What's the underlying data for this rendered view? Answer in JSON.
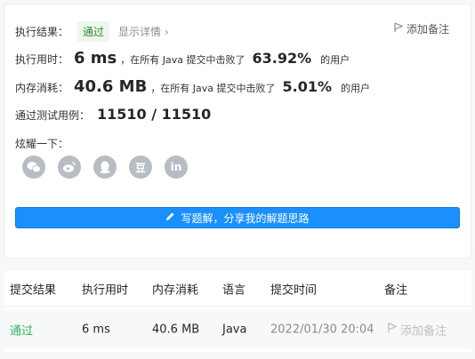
{
  "result": {
    "label": "执行结果：",
    "status": "通过",
    "detail_link": "显示详情 ›",
    "add_note": "添加备注"
  },
  "runtime": {
    "label": "执行用时：",
    "value": "6 ms",
    "text": "，在所有 Java 提交中击败了",
    "percent": "63.92%",
    "suffix": "的用户"
  },
  "memory": {
    "label": "内存消耗：",
    "value": "40.6 MB",
    "text": "，在所有 Java 提交中击败了",
    "percent": "5.01%",
    "suffix": "的用户"
  },
  "tests": {
    "label": "通过测试用例：",
    "value": "11510 / 11510"
  },
  "share": {
    "label": "炫耀一下：",
    "icons": [
      "wechat-icon",
      "weibo-icon",
      "qq-icon",
      "douban-icon",
      "linkedin-icon"
    ],
    "douban_glyph": "豆",
    "linkedin_glyph": "in"
  },
  "write_button": "写题解，分享我的解题思路",
  "table": {
    "headers": [
      "提交结果",
      "执行用时",
      "内存消耗",
      "语言",
      "提交时间",
      "备注"
    ],
    "row": {
      "status": "通过",
      "runtime": "6 ms",
      "memory": "40.6 MB",
      "language": "Java",
      "time": "2022/01/30 20:04",
      "note": "添加备注"
    }
  },
  "colors": {
    "accent": "#1a90ff",
    "success": "#2db55d",
    "icon_gray": "#b8bcc3"
  }
}
